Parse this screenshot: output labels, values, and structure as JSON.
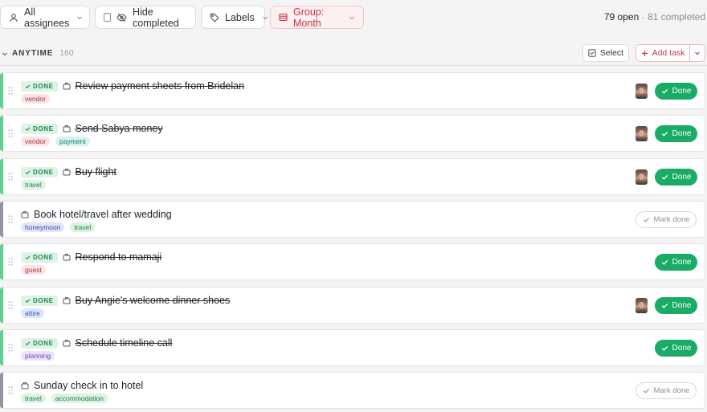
{
  "toolbar": {
    "assignees_label": "All assignees",
    "hide_completed_label": "Hide completed",
    "labels_label": "Labels",
    "group_label": "Group: Month",
    "open_count": "79 open",
    "separator": "·",
    "completed_count": "81 completed"
  },
  "section": {
    "title": "ANYTIME",
    "count": "160",
    "select_label": "Select",
    "add_task_label": "Add task"
  },
  "colors": {
    "accent": "#c8344a",
    "done_green": "#1aab66",
    "done_stripe": "#5fcf8d",
    "open_stripe": "#8f95a3"
  },
  "done_badge_label": "DONE",
  "done_button_label": "Done",
  "mark_done_label": "Mark done",
  "tasks": [
    {
      "title": "Review payment sheets from Bridelan",
      "status": "done",
      "has_avatar": true,
      "tags": [
        {
          "label": "vendor",
          "color": "pink"
        }
      ]
    },
    {
      "title": "Send Sabya money",
      "status": "done",
      "has_avatar": true,
      "tags": [
        {
          "label": "vendor",
          "color": "pink"
        },
        {
          "label": "payment",
          "color": "teal"
        }
      ]
    },
    {
      "title": "Buy flight",
      "status": "done",
      "has_avatar": true,
      "tags": [
        {
          "label": "travel",
          "color": "green"
        }
      ]
    },
    {
      "title": "Book hotel/travel after wedding",
      "status": "open",
      "has_avatar": false,
      "tags": [
        {
          "label": "honeymoon",
          "color": "indigo"
        },
        {
          "label": "travel",
          "color": "green"
        }
      ]
    },
    {
      "title": "Respond to mamaji",
      "status": "done",
      "has_avatar": false,
      "tags": [
        {
          "label": "guest",
          "color": "pink"
        }
      ]
    },
    {
      "title": "Buy Angie's welcome dinner shoes",
      "status": "done",
      "has_avatar": true,
      "tags": [
        {
          "label": "attire",
          "color": "blue"
        }
      ]
    },
    {
      "title": "Schedule timeline call",
      "status": "done",
      "has_avatar": false,
      "tags": [
        {
          "label": "planning",
          "color": "purple"
        }
      ]
    },
    {
      "title": "Sunday check in to hotel",
      "status": "open",
      "has_avatar": false,
      "tags": [
        {
          "label": "travel",
          "color": "green"
        },
        {
          "label": "accommodation",
          "color": "green"
        }
      ]
    }
  ]
}
